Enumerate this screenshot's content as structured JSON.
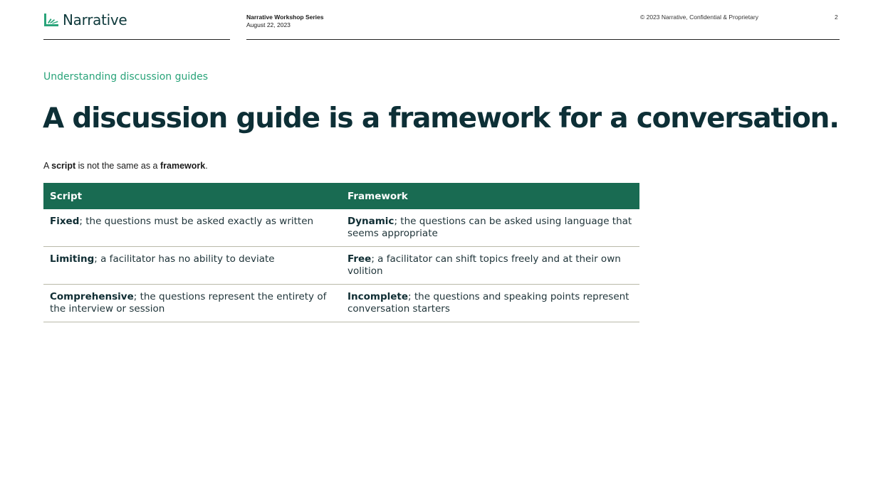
{
  "header": {
    "logo_text": "Narrative",
    "series_title": "Narrative Workshop Series",
    "date": "August 22, 2023",
    "copyright": "© 2023 Narrative, Confidential & Proprietary",
    "page_number": "2"
  },
  "slide": {
    "eyebrow": "Understanding discussion guides",
    "headline": "A discussion guide is a framework for a conversation.",
    "intro": {
      "part1": "A ",
      "term1": "script",
      "part2": " is not the same as a ",
      "term2": "framework",
      "part3": "."
    }
  },
  "table": {
    "headers": [
      "Script",
      "Framework"
    ],
    "rows": [
      {
        "script_term": "Fixed",
        "script_desc": "; the questions must be asked exactly as written",
        "framework_term": "Dynamic",
        "framework_desc": "; the questions can be asked using language that seems appropriate"
      },
      {
        "script_term": "Limiting",
        "script_desc": "; a facilitator has no ability to deviate",
        "framework_term": "Free",
        "framework_desc": "; a facilitator can shift topics freely and at their own volition"
      },
      {
        "script_term": "Comprehensive",
        "script_desc": "; the questions represent the entirety of the interview or session",
        "framework_term": "Incomplete",
        "framework_desc": "; the questions and speaking points represent conversation starters"
      }
    ]
  },
  "colors": {
    "accent": "#2aa47a",
    "table_header": "#196b52",
    "headline": "#0d2f36"
  }
}
